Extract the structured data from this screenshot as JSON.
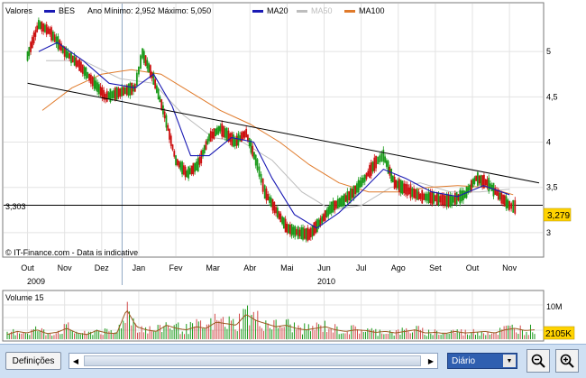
{
  "legend": {
    "prefix": "Valores",
    "symbol": "BES",
    "range_text": "Ano Mínimo: 2,952 Máximo: 5,050",
    "ma20": "MA20",
    "ma50": "MA50",
    "ma100": "MA100"
  },
  "colors": {
    "price_up": "#1a9a1a",
    "price_down": "#cc1111",
    "ma20": "#1a1ab4",
    "ma50": "#bdbdbd",
    "ma100": "#e07a2a",
    "trend": "#000000",
    "grid": "#e3e3e3",
    "volume_bar": "#d24a4a",
    "volume_ma": "#9a5a20",
    "toolbar": "#cfe0f3"
  },
  "watermark": "IT-Finance.com - Data is indicative",
  "ref_label": "3,303",
  "last_price_badge": "3,279",
  "volume": {
    "title": "Volume 15",
    "axis_label": "10M",
    "last_badge": "2105K"
  },
  "months": [
    "Out",
    "Nov",
    "Dez",
    "Jan",
    "Fev",
    "Mar",
    "Abr",
    "Mai",
    "Jun",
    "Jul",
    "Ago",
    "Set",
    "Out",
    "Nov"
  ],
  "years": [
    "2009",
    "2010"
  ],
  "toolbar": {
    "definitions_label": "Definições",
    "period_value": "Diário",
    "zoom_out_icon": "zoom-out-icon",
    "zoom_in_icon": "zoom-in-icon"
  },
  "chart_data": {
    "type": "line",
    "title": "",
    "series": [
      {
        "name": "BES",
        "kind": "price"
      },
      {
        "name": "MA20",
        "kind": "moving-average"
      },
      {
        "name": "MA50",
        "kind": "moving-average"
      },
      {
        "name": "MA100",
        "kind": "moving-average"
      }
    ],
    "x_ticks": [
      "Out",
      "Nov",
      "Dez",
      "Jan",
      "Fev",
      "Mar",
      "Abr",
      "Mai",
      "Jun",
      "Jul",
      "Ago",
      "Set",
      "Out",
      "Nov"
    ],
    "y_ticks": [
      "3",
      "3,5",
      "4",
      "4,5",
      "5"
    ],
    "ylim": [
      2.8,
      5.35
    ],
    "price_points": [
      {
        "x": 0,
        "y": 4.95
      },
      {
        "x": 0.3,
        "y": 5.3
      },
      {
        "x": 0.6,
        "y": 5.22
      },
      {
        "x": 1.0,
        "y": 5.0
      },
      {
        "x": 1.4,
        "y": 4.85
      },
      {
        "x": 1.8,
        "y": 4.65
      },
      {
        "x": 2.1,
        "y": 4.5
      },
      {
        "x": 2.5,
        "y": 4.55
      },
      {
        "x": 2.9,
        "y": 4.6
      },
      {
        "x": 3.1,
        "y": 4.98
      },
      {
        "x": 3.4,
        "y": 4.7
      },
      {
        "x": 3.7,
        "y": 4.3
      },
      {
        "x": 4.0,
        "y": 3.8
      },
      {
        "x": 4.3,
        "y": 3.65
      },
      {
        "x": 4.6,
        "y": 3.75
      },
      {
        "x": 4.9,
        "y": 4.05
      },
      {
        "x": 5.2,
        "y": 4.15
      },
      {
        "x": 5.6,
        "y": 4.0
      },
      {
        "x": 5.9,
        "y": 4.1
      },
      {
        "x": 6.2,
        "y": 3.75
      },
      {
        "x": 6.4,
        "y": 3.45
      },
      {
        "x": 6.7,
        "y": 3.25
      },
      {
        "x": 7.0,
        "y": 3.05
      },
      {
        "x": 7.3,
        "y": 3.0
      },
      {
        "x": 7.6,
        "y": 2.98
      },
      {
        "x": 7.9,
        "y": 3.12
      },
      {
        "x": 8.2,
        "y": 3.28
      },
      {
        "x": 8.5,
        "y": 3.35
      },
      {
        "x": 8.8,
        "y": 3.45
      },
      {
        "x": 9.1,
        "y": 3.6
      },
      {
        "x": 9.4,
        "y": 3.78
      },
      {
        "x": 9.6,
        "y": 3.85
      },
      {
        "x": 9.9,
        "y": 3.55
      },
      {
        "x": 10.2,
        "y": 3.48
      },
      {
        "x": 10.6,
        "y": 3.4
      },
      {
        "x": 11.0,
        "y": 3.38
      },
      {
        "x": 11.4,
        "y": 3.35
      },
      {
        "x": 11.8,
        "y": 3.42
      },
      {
        "x": 12.1,
        "y": 3.6
      },
      {
        "x": 12.4,
        "y": 3.55
      },
      {
        "x": 12.7,
        "y": 3.42
      },
      {
        "x": 13.0,
        "y": 3.3
      },
      {
        "x": 13.2,
        "y": 3.279
      }
    ],
    "ma20_points": [
      {
        "x": 0.3,
        "y": 5.0
      },
      {
        "x": 0.8,
        "y": 5.1
      },
      {
        "x": 1.5,
        "y": 4.9
      },
      {
        "x": 2.2,
        "y": 4.65
      },
      {
        "x": 2.9,
        "y": 4.6
      },
      {
        "x": 3.4,
        "y": 4.75
      },
      {
        "x": 3.9,
        "y": 4.4
      },
      {
        "x": 4.4,
        "y": 3.85
      },
      {
        "x": 4.9,
        "y": 3.85
      },
      {
        "x": 5.5,
        "y": 4.05
      },
      {
        "x": 6.1,
        "y": 4.0
      },
      {
        "x": 6.6,
        "y": 3.6
      },
      {
        "x": 7.2,
        "y": 3.2
      },
      {
        "x": 7.8,
        "y": 3.05
      },
      {
        "x": 8.4,
        "y": 3.22
      },
      {
        "x": 9.0,
        "y": 3.45
      },
      {
        "x": 9.6,
        "y": 3.7
      },
      {
        "x": 10.2,
        "y": 3.6
      },
      {
        "x": 10.9,
        "y": 3.45
      },
      {
        "x": 11.6,
        "y": 3.4
      },
      {
        "x": 12.3,
        "y": 3.52
      },
      {
        "x": 13.0,
        "y": 3.42
      }
    ],
    "ma50_points": [
      {
        "x": 0.5,
        "y": 4.9
      },
      {
        "x": 1.5,
        "y": 4.9
      },
      {
        "x": 2.5,
        "y": 4.7
      },
      {
        "x": 3.4,
        "y": 4.65
      },
      {
        "x": 4.2,
        "y": 4.3
      },
      {
        "x": 5.0,
        "y": 4.05
      },
      {
        "x": 5.8,
        "y": 4.0
      },
      {
        "x": 6.6,
        "y": 3.8
      },
      {
        "x": 7.4,
        "y": 3.45
      },
      {
        "x": 8.2,
        "y": 3.25
      },
      {
        "x": 9.0,
        "y": 3.3
      },
      {
        "x": 9.8,
        "y": 3.5
      },
      {
        "x": 10.6,
        "y": 3.55
      },
      {
        "x": 11.4,
        "y": 3.45
      },
      {
        "x": 12.2,
        "y": 3.45
      },
      {
        "x": 13.0,
        "y": 3.48
      }
    ],
    "ma100_points": [
      {
        "x": 0.4,
        "y": 4.35
      },
      {
        "x": 1.2,
        "y": 4.6
      },
      {
        "x": 2.0,
        "y": 4.75
      },
      {
        "x": 2.8,
        "y": 4.8
      },
      {
        "x": 3.6,
        "y": 4.75
      },
      {
        "x": 4.4,
        "y": 4.55
      },
      {
        "x": 5.2,
        "y": 4.35
      },
      {
        "x": 6.0,
        "y": 4.2
      },
      {
        "x": 6.8,
        "y": 4.0
      },
      {
        "x": 7.6,
        "y": 3.75
      },
      {
        "x": 8.4,
        "y": 3.55
      },
      {
        "x": 9.2,
        "y": 3.45
      },
      {
        "x": 10.0,
        "y": 3.45
      },
      {
        "x": 10.8,
        "y": 3.5
      },
      {
        "x": 11.6,
        "y": 3.52
      },
      {
        "x": 12.4,
        "y": 3.5
      },
      {
        "x": 13.1,
        "y": 3.42
      }
    ],
    "trendline": [
      {
        "x": 0,
        "y": 4.65
      },
      {
        "x": 13.8,
        "y": 3.55
      }
    ],
    "reference_line": 3.303,
    "volume_relative": [
      0.15,
      0.25,
      0.2,
      0.3,
      0.18,
      0.22,
      0.35,
      0.2,
      0.15,
      0.28,
      0.2,
      0.18,
      0.95,
      0.4,
      0.3,
      0.25,
      0.45,
      0.35,
      0.3,
      0.4,
      0.35,
      0.55,
      0.5,
      0.45,
      0.8,
      0.6,
      0.5,
      0.4,
      0.45,
      0.35,
      0.3,
      0.35,
      0.4,
      0.3,
      0.25,
      0.3,
      0.28,
      0.22,
      0.25,
      0.2,
      0.25,
      0.3,
      0.2,
      0.22,
      0.18,
      0.25,
      0.2,
      0.22,
      0.25,
      0.2,
      0.3,
      0.35,
      0.28,
      0.3
    ]
  }
}
